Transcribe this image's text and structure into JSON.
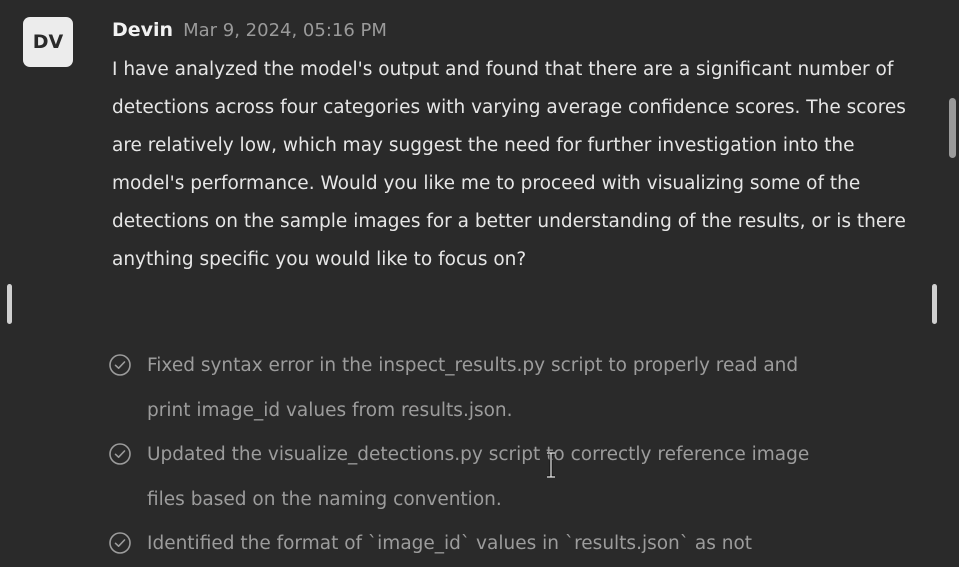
{
  "message": {
    "avatar_initials": "DV",
    "author": "Devin",
    "timestamp": "Mar 9, 2024, 05:16 PM",
    "body": "I have analyzed the model's output and found that there are a significant number of detections across four categories with varying average confidence scores. The scores are relatively low, which may suggest the need for further investigation into the model's performance. Would you like me to proceed with visualizing some of the detections on the sample images for a better understanding of the results, or is there anything specific you would like to focus on?"
  },
  "steps": [
    {
      "icon": "check-circle-icon",
      "text": "Fixed syntax error in the inspect_results.py script to properly read and print image_id values from results.json."
    },
    {
      "icon": "check-circle-icon",
      "text": "Updated the visualize_detections.py script to correctly reference image files based on the naming convention."
    },
    {
      "icon": "check-circle-icon",
      "text": "Identified the format of `image_id` values in `results.json` as not"
    }
  ]
}
